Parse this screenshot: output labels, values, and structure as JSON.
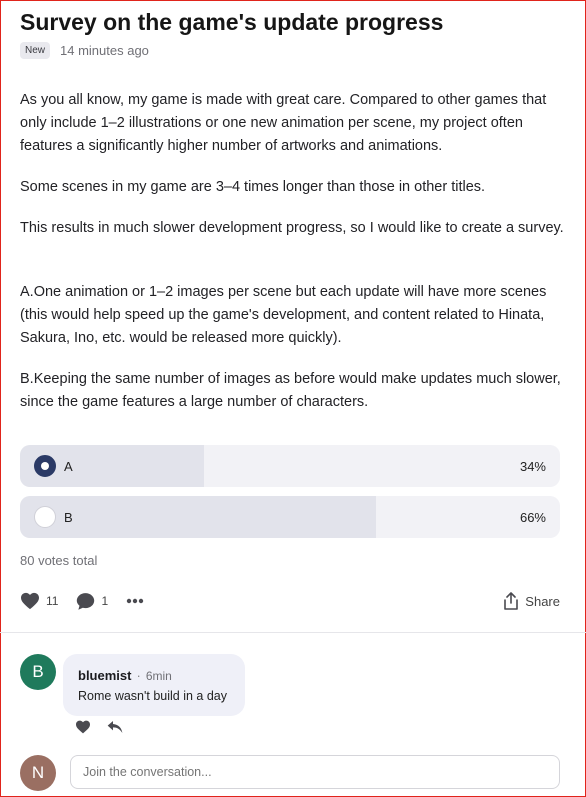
{
  "post": {
    "title": "Survey on the game's update progress",
    "badge": "New",
    "time": "14 minutes ago",
    "paragraphs": [
      "As you all know, my game is made with great care. Compared to other games that only include 1–2 illustrations or one new animation per scene, my project often features a significantly higher number of artworks and animations.",
      "Some scenes in my game are 3–4 times longer than those in other titles.",
      "This results in much slower development progress, so I would like to create a survey.",
      "A.One animation or 1–2 images per scene but each update will have more scenes (this would help speed up the game's development, and content related to Hinata, Sakura, Ino, etc. would be released more quickly).",
      "B.Keeping the same number of images as before would make updates much slower, since the game features a large number of characters."
    ]
  },
  "poll": {
    "options": [
      {
        "label": "A",
        "percent": "34%",
        "fraction": 0.34,
        "selected": true
      },
      {
        "label": "B",
        "percent": "66%",
        "fraction": 0.66,
        "selected": false
      }
    ],
    "votes_total": "80 votes total"
  },
  "actions": {
    "likes": "11",
    "comments": "1",
    "share_label": "Share"
  },
  "comments": [
    {
      "avatar_letter": "B",
      "avatar_color": "#1f7a5c",
      "author": "bluemist",
      "time": "6min",
      "text": "Rome wasn't build in a day"
    }
  ],
  "composer": {
    "avatar_letter": "N",
    "avatar_color": "#9a6f62",
    "placeholder": "Join the conversation..."
  },
  "colors": {
    "accent": "#2b3a66",
    "frame": "#e0241b"
  }
}
